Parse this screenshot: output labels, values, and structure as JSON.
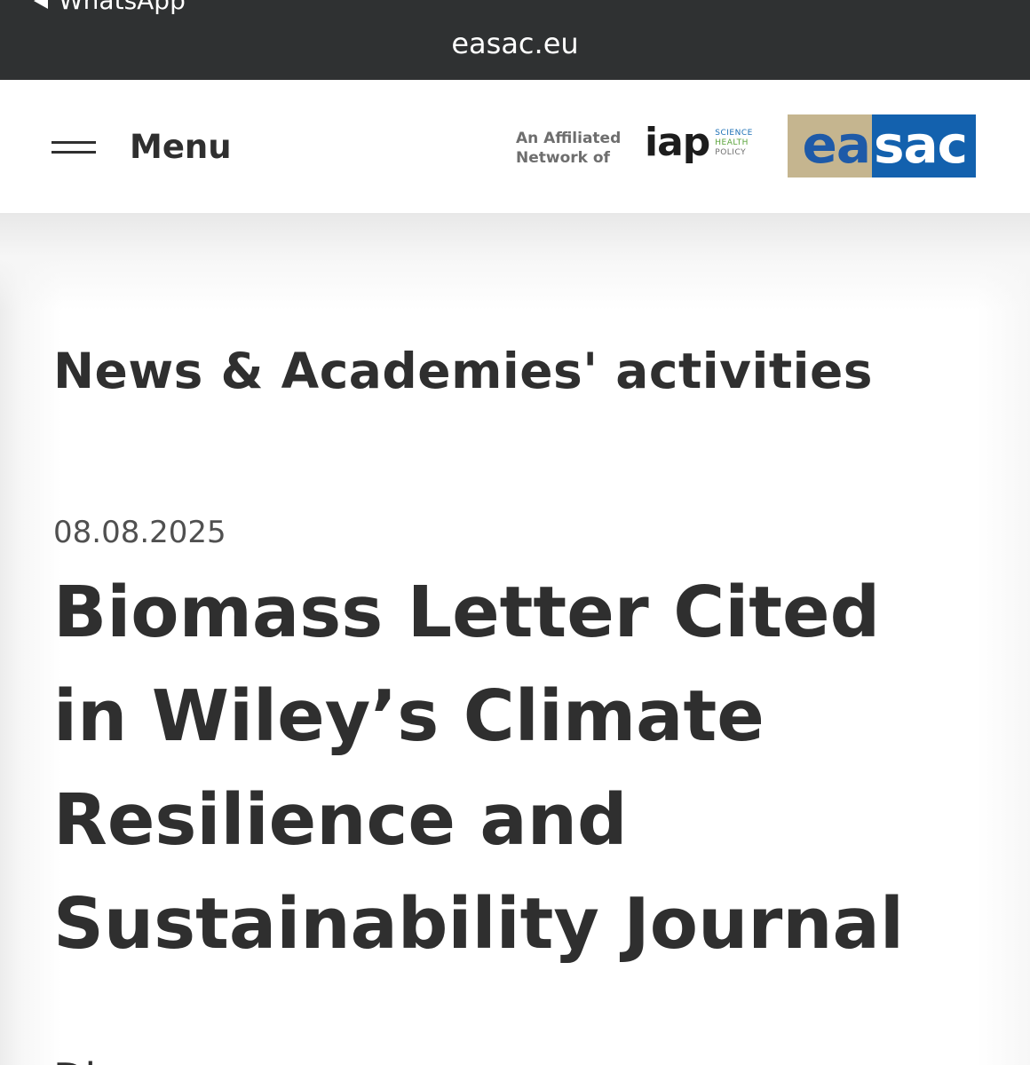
{
  "browser": {
    "back_label": "WhatsApp",
    "url": "easac.eu"
  },
  "header": {
    "menu_label": "Menu",
    "affiliation_line1": "An Affiliated",
    "affiliation_line2": "Network of",
    "iap_logo": {
      "word": "iap",
      "tag1": "SCIENCE",
      "tag2": "HEALTH",
      "tag3": "POLICY",
      "tag_colors": [
        "#1b6fb5",
        "#5aa33a",
        "#6e6e6e"
      ]
    },
    "easac_logo": {
      "part1": "ea",
      "part2": "sac",
      "colors": {
        "gold": "#c5b58f",
        "blue": "#1361ae"
      }
    }
  },
  "main": {
    "section_title": "News & Academies' activities",
    "date": "08.08.2025",
    "article_title": "Biomass Letter Cited in Wiley’s Climate Resilience and Sustainability Journal",
    "teaser_partial": "Di"
  }
}
